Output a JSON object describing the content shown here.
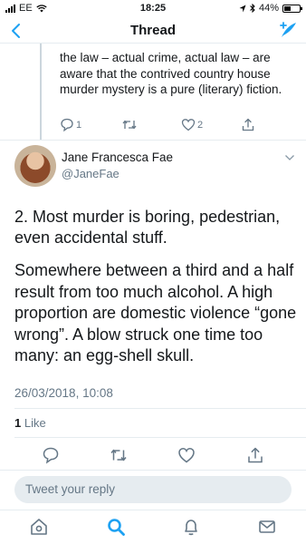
{
  "status": {
    "carrier": "EE",
    "time": "18:25",
    "battery": "44%",
    "battery_level": 0.44
  },
  "nav": {
    "title": "Thread",
    "back_icon": "chevron-left-icon",
    "compose_icon": "compose-tweet-icon"
  },
  "previous_tweet": {
    "text": "the law –  actual crime, actual law – are aware that the contrived country house murder mystery is a pure (literary) fiction.",
    "reply_count": "1",
    "retweet_count": "",
    "like_count": "2"
  },
  "tweet": {
    "name": "Jane Francesca Fae",
    "handle": "@JaneFae",
    "paragraph1": "2.  Most murder is boring, pedestrian, even accidental stuff.",
    "paragraph2": "Somewhere between a third and a half result from too much alcohol. A high proportion are domestic violence “gone wrong”. A blow struck one time too many: an egg-shell skull.",
    "timestamp": "26/03/2018, 10:08",
    "likes_count": "1",
    "likes_label": "Like"
  },
  "reply": {
    "placeholder": "Tweet your reply"
  },
  "colors": {
    "accent": "#1da1f2",
    "text": "#14171a",
    "secondary": "#657786",
    "divider": "#e6ecf0"
  },
  "tabs": [
    "home-icon",
    "search-icon",
    "notifications-icon",
    "messages-icon"
  ]
}
